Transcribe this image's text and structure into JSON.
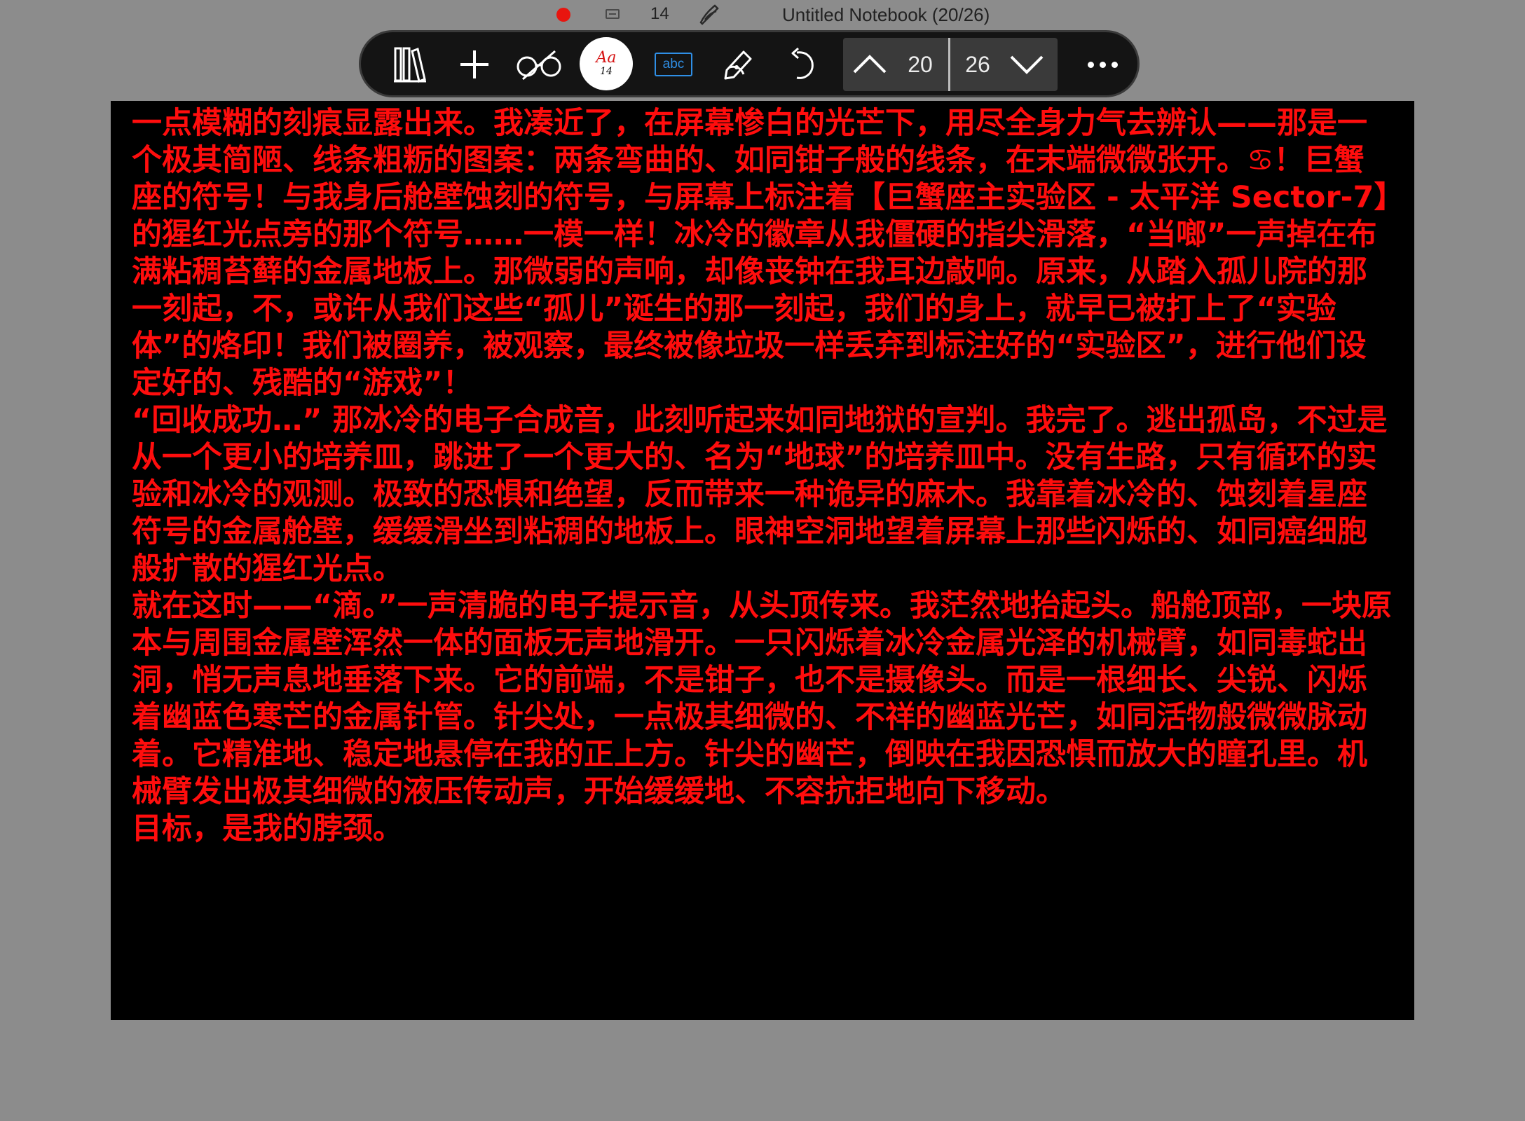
{
  "status_bar": {
    "font_size": "14",
    "title": "Untitled Notebook (20/26)",
    "record_color": "#e8150f"
  },
  "toolbar": {
    "font_button": {
      "sample": "Aa",
      "size": "14",
      "accent": "#d61414"
    },
    "abc_label": "abc",
    "current_page": "20",
    "total_pages": "26",
    "icons": [
      "library-icon",
      "add-icon",
      "glasses-icon",
      "font-icon",
      "text-recognition-icon",
      "pen-icon",
      "undo-icon",
      "page-up-icon",
      "page-down-icon",
      "more-icon"
    ]
  },
  "page": {
    "text_color": "#ff0d0d",
    "background": "#000000",
    "paragraphs": [
      "一点模糊的刻痕显露出来。我凑近了，在屏幕惨白的光芒下，用尽全身力气去辨认——那是一个极其简陋、线条粗粝的图案：两条弯曲的、如同钳子般的线条，在末端微微张开。♋！巨蟹座的符号！与我身后舱壁蚀刻的符号，与屏幕上标注着【巨蟹座主实验区 - 太平洋 Sector-7】的猩红光点旁的那个符号……一模一样！冰冷的徽章从我僵硬的指尖滑落，“当啷”一声掉在布满粘稠苔藓的金属地板上。那微弱的声响，却像丧钟在我耳边敲响。原来，从踏入孤儿院的那一刻起，不，或许从我们这些“孤儿”诞生的那一刻起，我们的身上，就早已被打上了“实验体”的烙印！我们被圈养，被观察，最终被像垃圾一样丢弃到标注好的“实验区”，进行他们设定好的、残酷的“游戏”！",
      "“回收成功…” 那冰冷的电子合成音，此刻听起来如同地狱的宣判。我完了。逃出孤岛，不过是从一个更小的培养皿，跳进了一个更大的、名为“地球”的培养皿中。没有生路，只有循环的实验和冰冷的观测。极致的恐惧和绝望，反而带来一种诡异的麻木。我靠着冰冷的、蚀刻着星座符号的金属舱壁，缓缓滑坐到粘稠的地板上。眼神空洞地望着屏幕上那些闪烁的、如同癌细胞般扩散的猩红光点。",
      "就在这时——“滴。”一声清脆的电子提示音，从头顶传来。我茫然地抬起头。船舱顶部，一块原本与周围金属壁浑然一体的面板无声地滑开。一只闪烁着冰冷金属光泽的机械臂，如同毒蛇出洞，悄无声息地垂落下来。它的前端，不是钳子，也不是摄像头。而是一根细长、尖锐、闪烁着幽蓝色寒芒的金属针管。针尖处，一点极其细微的、不祥的幽蓝光芒，如同活物般微微脉动着。它精准地、稳定地悬停在我的正上方。针尖的幽芒，倒映在我因恐惧而放大的瞳孔里。机械臂发出极其细微的液压传动声，开始缓缓地、不容抗拒地向下移动。",
      "目标，是我的脖颈。"
    ]
  }
}
